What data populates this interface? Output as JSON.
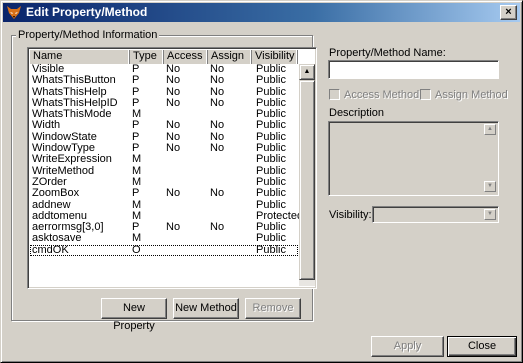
{
  "window": {
    "title": "Edit Property/Method",
    "close_glyph": "×"
  },
  "group": {
    "label": "Property/Method Information"
  },
  "columns": [
    "Name",
    "Type",
    "Access",
    "Assign",
    "Visibility"
  ],
  "rows": [
    {
      "name": "Visible",
      "type": "P",
      "access": "No",
      "assign": "No",
      "visibility": "Public"
    },
    {
      "name": "WhatsThisButton",
      "type": "P",
      "access": "No",
      "assign": "No",
      "visibility": "Public"
    },
    {
      "name": "WhatsThisHelp",
      "type": "P",
      "access": "No",
      "assign": "No",
      "visibility": "Public"
    },
    {
      "name": "WhatsThisHelpID",
      "type": "P",
      "access": "No",
      "assign": "No",
      "visibility": "Public"
    },
    {
      "name": "WhatsThisMode",
      "type": "M",
      "access": "",
      "assign": "",
      "visibility": "Public"
    },
    {
      "name": "Width",
      "type": "P",
      "access": "No",
      "assign": "No",
      "visibility": "Public"
    },
    {
      "name": "WindowState",
      "type": "P",
      "access": "No",
      "assign": "No",
      "visibility": "Public"
    },
    {
      "name": "WindowType",
      "type": "P",
      "access": "No",
      "assign": "No",
      "visibility": "Public"
    },
    {
      "name": "WriteExpression",
      "type": "M",
      "access": "",
      "assign": "",
      "visibility": "Public"
    },
    {
      "name": "WriteMethod",
      "type": "M",
      "access": "",
      "assign": "",
      "visibility": "Public"
    },
    {
      "name": "ZOrder",
      "type": "M",
      "access": "",
      "assign": "",
      "visibility": "Public"
    },
    {
      "name": "ZoomBox",
      "type": "P",
      "access": "No",
      "assign": "No",
      "visibility": "Public"
    },
    {
      "name": "addnew",
      "type": "M",
      "access": "",
      "assign": "",
      "visibility": "Public"
    },
    {
      "name": "addtomenu",
      "type": "M",
      "access": "",
      "assign": "",
      "visibility": "Protected"
    },
    {
      "name": "aerrormsg[3,0]",
      "type": "P",
      "access": "No",
      "assign": "No",
      "visibility": "Public"
    },
    {
      "name": "asktosave",
      "type": "M",
      "access": "",
      "assign": "",
      "visibility": "Public"
    },
    {
      "name": "cmdOK",
      "type": "O",
      "access": "",
      "assign": "",
      "visibility": "Public"
    }
  ],
  "buttons": {
    "new_property": "New Property",
    "new_method": "New Method",
    "remove": "Remove",
    "apply": "Apply",
    "close": "Close"
  },
  "right_panel": {
    "name_label": "Property/Method Name:",
    "name_value": "",
    "access_method": "Access Method",
    "assign_method": "Assign Method",
    "description_label": "Description",
    "description_value": "",
    "visibility_label": "Visibility:",
    "visibility_value": ""
  },
  "icons": {
    "app": "fox-icon",
    "scroll_up": "▲",
    "scroll_down": "▼"
  },
  "colors": {
    "titlebar_start": "#0a246a",
    "titlebar_end": "#a6caf0",
    "face": "#d4d0c8"
  }
}
